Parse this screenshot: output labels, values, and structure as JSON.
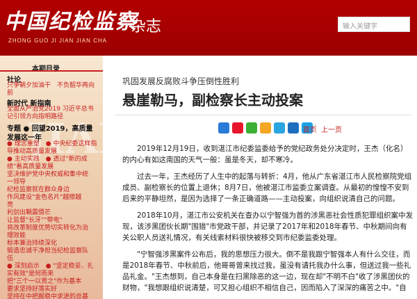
{
  "header": {
    "logo_cn": "中国纪检监察",
    "logo_en": "ZHONG GUO JI JIAN JIAN CHA",
    "magazine": "杂志",
    "search_placeholder": "输入关键字"
  },
  "sidebar": {
    "toc_title": "本期目录",
    "watermark": "JIAN",
    "sections": [
      {
        "label": "社论",
        "items": [
          "只争朝夕加油干　不负韶华再向",
          "前"
        ]
      },
      {
        "label": "新时代 新指南",
        "items": [
          "全面从严治党2019 习近平总书",
          "记引领方向指明路径"
        ]
      },
      {
        "label": "专题 ● 回望2019，高质量",
        "items": []
      },
      {
        "label": "发展这一年",
        "items": [
          "● 理念重塑　● 中央纪委这样指",
          "导推动高质量发展",
          "● 主动实践　● 透过\"新的成",
          "绩\"看高质量发展",
          "坚决维护党中央权威和集中统",
          "一领导",
          "纪检监察就在群众身边",
          "作风建设\"金色名片\"越擦越",
          "亮",
          "利剑出鞘震慑芒",
          "让监督\"长牙\"\"带电\"",
          "将改革制度优势切实转化为治",
          "理效能",
          "标本兼治持续深化",
          "锻造忠诚干净担当纪检监察队",
          "伍",
          "● 深刻启示　● \"坚定稳妥、扎",
          "实有效\"是何而来",
          "把\"三个一以贯之\"作为基本",
          "要求坚持好落实好",
          "坚持在中把握稳中求进的总基"
        ]
      }
    ]
  },
  "article": {
    "kicker": "巩固发展反腐败斗争压倒性胜利",
    "title": "悬崖勒马，副检察长主动投案",
    "nav_home": "首页",
    "nav_prev": "上一页",
    "paragraphs": [
      "2019年12月19日，收到湛江市纪委监委给予的党纪政务处分决定时，王杰（化名）的内心有如这南国的天气一般：虽是冬天，却不寒冷。",
      "过去一年，王杰经历了人生中的起落与转折：4月，他从广东省湛江市人民检察院党组成员、副检察长的位置上退休；8月7日，他被湛江市监委立案调查。从最初的惶惶不安到后来的平静坦然，是因为选择了一条正确道路——主动投案，向组织说清自己的问题。",
      "2018年10月，湛江市公安机关在查办以宁智强为首的涉黑恶社会性质犯罪组织案中发现，该涉黑团伙长期\"围猎\"市党政干部，并记录了2017年和2018年春节、中秋期间向有关公职人员送礼情况，有关线索材料很快被移交到市纪委监委处理。",
      "\"宁智强涉黑案件公布后，我的思想压力很大。倒不是我跟宁智强本人有什么交往，而是2018年春节、中秋前后，他哥哥曾来找过我，虽没有请托我办什么事，但送过我一些礼品礼金。\"王杰想到，自己本身是在扫黑除恶的这一边，现在却\"不明不白\"收了涉黑团伙的财物，\"我想跟组织说清楚，可又担心组织不相信自己，因而陷入了深深的痛苦之中。\"自"
    ]
  },
  "share_icons": [
    {
      "name": "plus-share-icon",
      "color": "#2a7ad8"
    },
    {
      "name": "weibo-icon",
      "color": "#e6162d"
    },
    {
      "name": "wechat-icon",
      "color": "#3cb034"
    },
    {
      "name": "qzone-icon",
      "color": "#f5a623"
    },
    {
      "name": "tencent-weibo-icon",
      "color": "#2aa5e0"
    },
    {
      "name": "renren-icon",
      "color": "#1f6fbf"
    },
    {
      "name": "qq-icon",
      "color": "#1aa1e8"
    }
  ],
  "colors": {
    "brand_red": "#b30000",
    "link_red": "#c81e1e"
  }
}
